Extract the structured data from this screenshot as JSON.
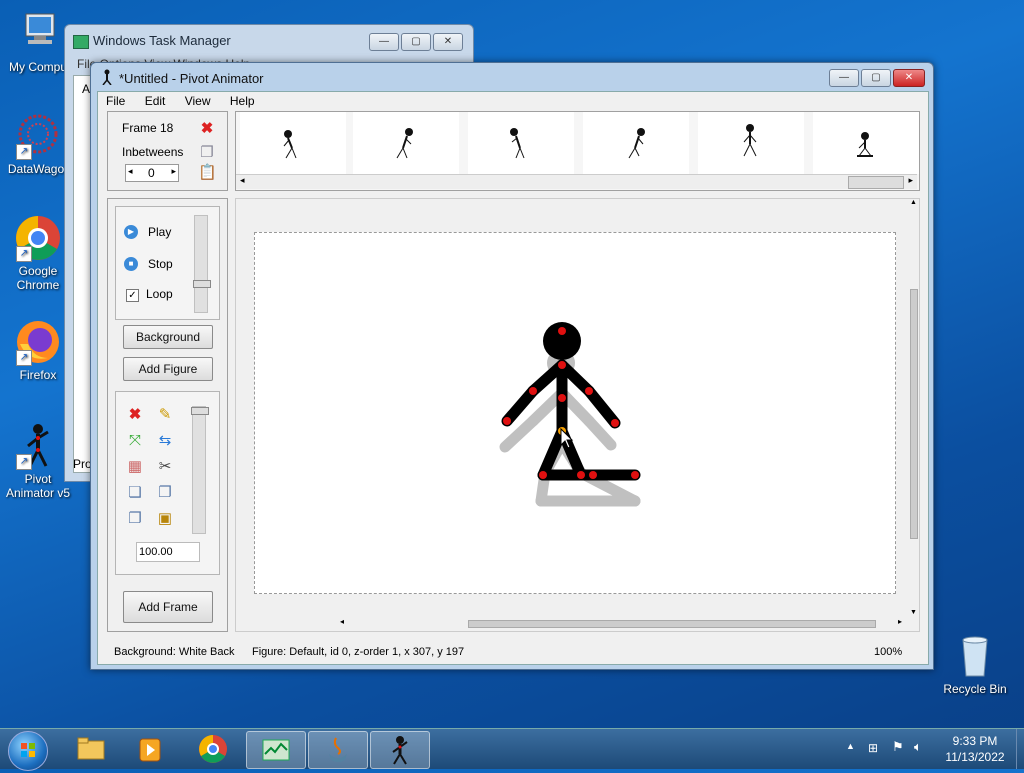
{
  "desktop": {
    "icons": [
      {
        "label": "My Compu"
      },
      {
        "label": "DataWagor"
      },
      {
        "label": "Google Chrome"
      },
      {
        "label": "Firefox"
      },
      {
        "label": "Pivot Animator v5"
      },
      {
        "label": "Recycle Bin"
      }
    ]
  },
  "task_manager": {
    "title": "Windows Task Manager",
    "menu_partial": "File  Options  View  Windows  Help",
    "left_letter": "A",
    "bottom_text": "Pro"
  },
  "pivot": {
    "title": "*Untitled - Pivot Animator",
    "menu": [
      "File",
      "Edit",
      "View",
      "Help"
    ],
    "frame_label": "Frame 18",
    "inbetweens_label": "Inbetweens",
    "inbetweens_value": "0",
    "play_label": "Play",
    "stop_label": "Stop",
    "loop_label": "Loop",
    "loop_checked": true,
    "background_button": "Background",
    "add_figure_button": "Add Figure",
    "scale_value": "100.00",
    "add_frame_button": "Add Frame",
    "status_background": "Background: White Back",
    "status_figure": "Figure: Default,  id 0,  z-order 1,  x 307, y 197",
    "status_zoom": "100%",
    "frame_count_visible": 6
  },
  "taskbar": {
    "time": "9:33 PM",
    "date": "11/13/2022"
  },
  "colors": {
    "joint_red": "#e01010",
    "figure_black": "#000000",
    "onion_gray": "#c0c0c0",
    "taskbar_blue": "#1d4a78"
  }
}
